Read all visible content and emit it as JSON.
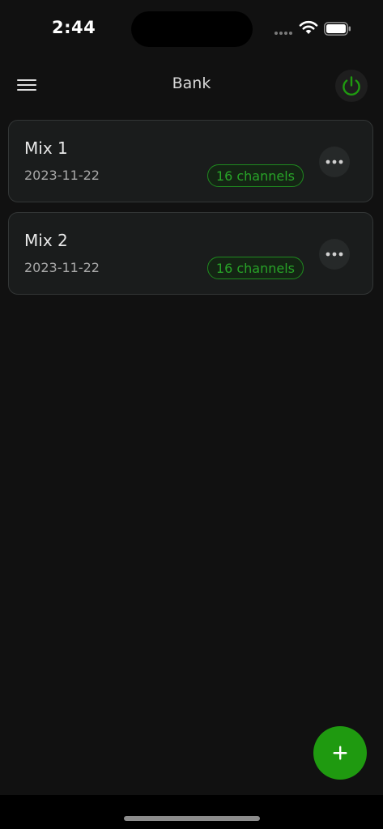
{
  "status_bar": {
    "time": "2:44"
  },
  "header": {
    "title": "Bank",
    "menu_icon": "hamburger-menu-icon",
    "power_icon": "power-icon"
  },
  "colors": {
    "background": "#111111",
    "card": "#1a1c1c",
    "accent_green": "#1f9a10",
    "badge_text": "#28a428"
  },
  "mixes": [
    {
      "name": "Mix 1",
      "date": "2023-11-22",
      "channels_label": "16 channels"
    },
    {
      "name": "Mix 2",
      "date": "2023-11-22",
      "channels_label": "16 channels"
    }
  ],
  "fab": {
    "icon": "plus-icon"
  }
}
